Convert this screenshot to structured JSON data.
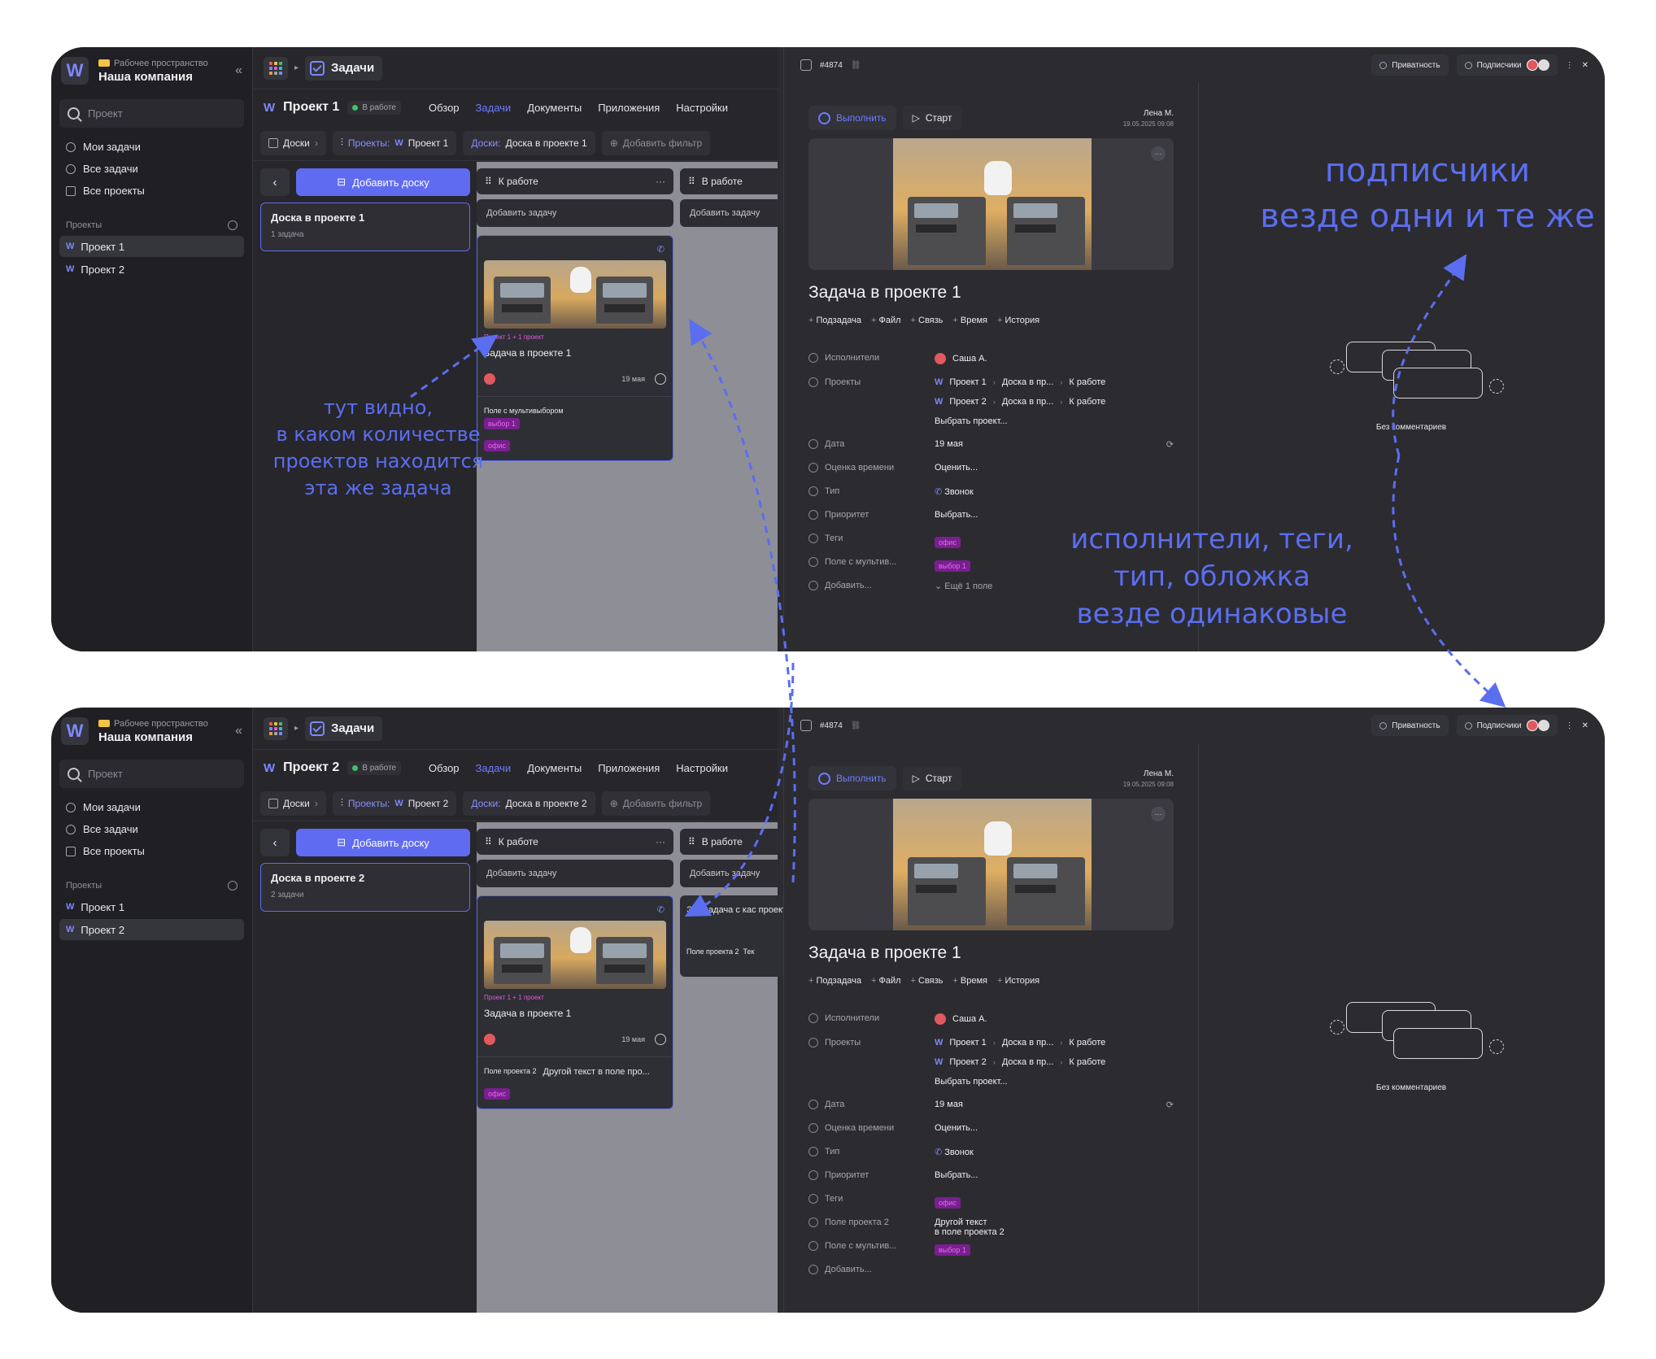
{
  "workspace": {
    "label": "Рабочее пространство",
    "name": "Наша компания"
  },
  "sidebar": {
    "search_placeholder": "Проект",
    "nav": [
      "Мои задачи",
      "Все задачи",
      "Все проекты"
    ],
    "projects_title": "Проекты",
    "projects": [
      "Проект 1",
      "Проект 2"
    ]
  },
  "topbar": {
    "section": "Задачи"
  },
  "tabs": [
    "Обзор",
    "Задачи",
    "Документы",
    "Приложения",
    "Настройки"
  ],
  "status": "В работе",
  "filters": {
    "boards": "Доски",
    "projects_label": "Проекты:",
    "boards_label": "Доски:",
    "add_filter": "Добавить фильтр"
  },
  "board": {
    "add_board": "Добавить доску",
    "columns": [
      "К работе",
      "В работе"
    ],
    "add_task": "Добавить задачу"
  },
  "windows": [
    {
      "project": "Проект 1",
      "board_item": {
        "title": "Доска в проекте 1",
        "count": "1 задача"
      },
      "board_filter": "Доска в проекте 1",
      "card": {
        "tag_line": "Проект 1 + 1 проект",
        "title": "Задача в проекте 1",
        "date": "19 мая",
        "field_name": "Поле с мультивыбором",
        "field_value": "выбор 1",
        "tag": "офис"
      }
    },
    {
      "project": "Проект 2",
      "board_item": {
        "title": "Доска в проекте 2",
        "count": "2 задачи"
      },
      "board_filter": "Доска в проекте 2",
      "card": {
        "tag_line": "Проект 1 + 1 проект",
        "title": "Задача в проекте 1",
        "date": "19 мая",
        "field_name": "Поле проекта 2",
        "field_value": "Другой текст в поле про...",
        "tag": "офис"
      },
      "other_card": {
        "title": "Это задача с кас проекта",
        "field": "Поле проекта 2",
        "value": "Тек"
      }
    }
  ],
  "detail": {
    "id": "#4874",
    "privacy": "Приватность",
    "subscribers": "Подписчики",
    "done": "Выполнить",
    "start": "Старт",
    "author": "Лена М.",
    "author_date": "19.05.2025 09:08",
    "title": "Задача в проекте 1",
    "quick": [
      "Подзадача",
      "Файл",
      "Связь",
      "Время",
      "История"
    ],
    "labels": {
      "assignees": "Исполнители",
      "projects": "Проекты",
      "date": "Дата",
      "estimate": "Оценка времени",
      "type": "Тип",
      "priority": "Приоритет",
      "tags": "Теги",
      "multi": "Поле с мультив...",
      "proj2_field": "Поле проекта 2",
      "add": "Добавить..."
    },
    "assignee": "Саша А.",
    "proj_rows": [
      {
        "project": "Проект 1",
        "board": "Доска в пр...",
        "column": "К работе"
      },
      {
        "project": "Проект 2",
        "board": "Доска в пр...",
        "column": "К работе"
      }
    ],
    "choose_project": "Выбрать проект...",
    "date": "19 мая",
    "estimate": "Оценить...",
    "type": "Звонок",
    "priority": "Выбрать...",
    "tag": "офис",
    "multi_value": "выбор 1",
    "more_fields": "Ещё 1 поле",
    "proj2_value_1": "Другой текст",
    "proj2_value_2": "в поле проекта 2",
    "no_comments": "Без комментариев"
  },
  "notes": {
    "left": [
      "тут видно,",
      "в каком количестве",
      "проектов находится",
      "эта же задача"
    ],
    "subs": [
      "подписчики",
      "везде одни и те же"
    ],
    "same": [
      "исполнители, теги,",
      "тип, обложка",
      "везде одинаковые"
    ]
  },
  "colors": {
    "accent": "#5f6cf2",
    "note": "#5b6ef0",
    "bg": "#2b2b30"
  }
}
